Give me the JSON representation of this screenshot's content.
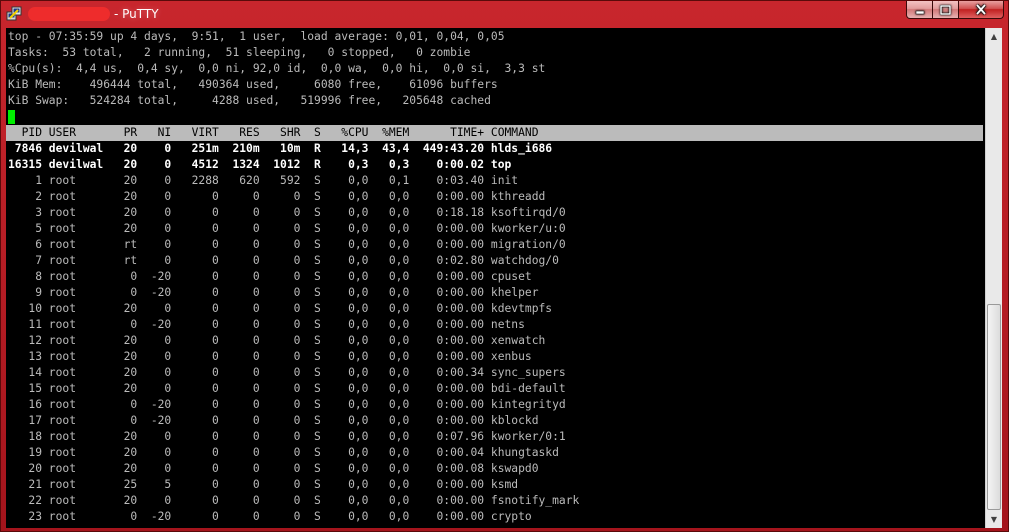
{
  "window": {
    "title": "- PuTTY",
    "colors": {
      "titlebar": "#b81c22",
      "redaction": "#ee2c2c",
      "cursor": "#00ee00",
      "highlight_bar": "#bbbbbb"
    },
    "icons": {
      "app": "putty-icon",
      "minimize": "minimize-icon",
      "maximize": "maximize-icon",
      "close": "close-icon"
    }
  },
  "top": {
    "summary": [
      "top - 07:35:59 up 4 days,  9:51,  1 user,  load average: 0,01, 0,04, 0,05",
      "Tasks:  53 total,   2 running,  51 sleeping,   0 stopped,   0 zombie",
      "%Cpu(s):  4,4 us,  0,4 sy,  0,0 ni, 92,0 id,  0,0 wa,  0,0 hi,  0,0 si,  3,3 st",
      "KiB Mem:    496444 total,   490364 used,     6080 free,    61096 buffers",
      "KiB Swap:   524284 total,     4288 used,   519996 free,   205648 cached"
    ],
    "columns": [
      "PID",
      "USER",
      "PR",
      "NI",
      "VIRT",
      "RES",
      "SHR",
      "S",
      "%CPU",
      "%MEM",
      "TIME+",
      "COMMAND"
    ],
    "processes": [
      {
        "pid": "7846",
        "user": "devilwal",
        "pr": "20",
        "ni": "0",
        "virt": "251m",
        "res": "210m",
        "shr": "10m",
        "s": "R",
        "cpu": "14,3",
        "mem": "43,4",
        "time": "449:43.20",
        "command": "hlds_i686",
        "bold": true
      },
      {
        "pid": "16315",
        "user": "devilwal",
        "pr": "20",
        "ni": "0",
        "virt": "4512",
        "res": "1324",
        "shr": "1012",
        "s": "R",
        "cpu": "0,3",
        "mem": "0,3",
        "time": "0:00.02",
        "command": "top",
        "bold": true
      },
      {
        "pid": "1",
        "user": "root",
        "pr": "20",
        "ni": "0",
        "virt": "2288",
        "res": "620",
        "shr": "592",
        "s": "S",
        "cpu": "0,0",
        "mem": "0,1",
        "time": "0:03.40",
        "command": "init"
      },
      {
        "pid": "2",
        "user": "root",
        "pr": "20",
        "ni": "0",
        "virt": "0",
        "res": "0",
        "shr": "0",
        "s": "S",
        "cpu": "0,0",
        "mem": "0,0",
        "time": "0:00.00",
        "command": "kthreadd"
      },
      {
        "pid": "3",
        "user": "root",
        "pr": "20",
        "ni": "0",
        "virt": "0",
        "res": "0",
        "shr": "0",
        "s": "S",
        "cpu": "0,0",
        "mem": "0,0",
        "time": "0:18.18",
        "command": "ksoftirqd/0"
      },
      {
        "pid": "5",
        "user": "root",
        "pr": "20",
        "ni": "0",
        "virt": "0",
        "res": "0",
        "shr": "0",
        "s": "S",
        "cpu": "0,0",
        "mem": "0,0",
        "time": "0:00.00",
        "command": "kworker/u:0"
      },
      {
        "pid": "6",
        "user": "root",
        "pr": "rt",
        "ni": "0",
        "virt": "0",
        "res": "0",
        "shr": "0",
        "s": "S",
        "cpu": "0,0",
        "mem": "0,0",
        "time": "0:00.00",
        "command": "migration/0"
      },
      {
        "pid": "7",
        "user": "root",
        "pr": "rt",
        "ni": "0",
        "virt": "0",
        "res": "0",
        "shr": "0",
        "s": "S",
        "cpu": "0,0",
        "mem": "0,0",
        "time": "0:02.80",
        "command": "watchdog/0"
      },
      {
        "pid": "8",
        "user": "root",
        "pr": "0",
        "ni": "-20",
        "virt": "0",
        "res": "0",
        "shr": "0",
        "s": "S",
        "cpu": "0,0",
        "mem": "0,0",
        "time": "0:00.00",
        "command": "cpuset"
      },
      {
        "pid": "9",
        "user": "root",
        "pr": "0",
        "ni": "-20",
        "virt": "0",
        "res": "0",
        "shr": "0",
        "s": "S",
        "cpu": "0,0",
        "mem": "0,0",
        "time": "0:00.00",
        "command": "khelper"
      },
      {
        "pid": "10",
        "user": "root",
        "pr": "20",
        "ni": "0",
        "virt": "0",
        "res": "0",
        "shr": "0",
        "s": "S",
        "cpu": "0,0",
        "mem": "0,0",
        "time": "0:00.00",
        "command": "kdevtmpfs"
      },
      {
        "pid": "11",
        "user": "root",
        "pr": "0",
        "ni": "-20",
        "virt": "0",
        "res": "0",
        "shr": "0",
        "s": "S",
        "cpu": "0,0",
        "mem": "0,0",
        "time": "0:00.00",
        "command": "netns"
      },
      {
        "pid": "12",
        "user": "root",
        "pr": "20",
        "ni": "0",
        "virt": "0",
        "res": "0",
        "shr": "0",
        "s": "S",
        "cpu": "0,0",
        "mem": "0,0",
        "time": "0:00.00",
        "command": "xenwatch"
      },
      {
        "pid": "13",
        "user": "root",
        "pr": "20",
        "ni": "0",
        "virt": "0",
        "res": "0",
        "shr": "0",
        "s": "S",
        "cpu": "0,0",
        "mem": "0,0",
        "time": "0:00.00",
        "command": "xenbus"
      },
      {
        "pid": "14",
        "user": "root",
        "pr": "20",
        "ni": "0",
        "virt": "0",
        "res": "0",
        "shr": "0",
        "s": "S",
        "cpu": "0,0",
        "mem": "0,0",
        "time": "0:00.34",
        "command": "sync_supers"
      },
      {
        "pid": "15",
        "user": "root",
        "pr": "20",
        "ni": "0",
        "virt": "0",
        "res": "0",
        "shr": "0",
        "s": "S",
        "cpu": "0,0",
        "mem": "0,0",
        "time": "0:00.00",
        "command": "bdi-default"
      },
      {
        "pid": "16",
        "user": "root",
        "pr": "0",
        "ni": "-20",
        "virt": "0",
        "res": "0",
        "shr": "0",
        "s": "S",
        "cpu": "0,0",
        "mem": "0,0",
        "time": "0:00.00",
        "command": "kintegrityd"
      },
      {
        "pid": "17",
        "user": "root",
        "pr": "0",
        "ni": "-20",
        "virt": "0",
        "res": "0",
        "shr": "0",
        "s": "S",
        "cpu": "0,0",
        "mem": "0,0",
        "time": "0:00.00",
        "command": "kblockd"
      },
      {
        "pid": "18",
        "user": "root",
        "pr": "20",
        "ni": "0",
        "virt": "0",
        "res": "0",
        "shr": "0",
        "s": "S",
        "cpu": "0,0",
        "mem": "0,0",
        "time": "0:07.96",
        "command": "kworker/0:1"
      },
      {
        "pid": "19",
        "user": "root",
        "pr": "20",
        "ni": "0",
        "virt": "0",
        "res": "0",
        "shr": "0",
        "s": "S",
        "cpu": "0,0",
        "mem": "0,0",
        "time": "0:00.04",
        "command": "khungtaskd"
      },
      {
        "pid": "20",
        "user": "root",
        "pr": "20",
        "ni": "0",
        "virt": "0",
        "res": "0",
        "shr": "0",
        "s": "S",
        "cpu": "0,0",
        "mem": "0,0",
        "time": "0:00.08",
        "command": "kswapd0"
      },
      {
        "pid": "21",
        "user": "root",
        "pr": "25",
        "ni": "5",
        "virt": "0",
        "res": "0",
        "shr": "0",
        "s": "S",
        "cpu": "0,0",
        "mem": "0,0",
        "time": "0:00.00",
        "command": "ksmd"
      },
      {
        "pid": "22",
        "user": "root",
        "pr": "20",
        "ni": "0",
        "virt": "0",
        "res": "0",
        "shr": "0",
        "s": "S",
        "cpu": "0,0",
        "mem": "0,0",
        "time": "0:00.00",
        "command": "fsnotify_mark"
      },
      {
        "pid": "23",
        "user": "root",
        "pr": "0",
        "ni": "-20",
        "virt": "0",
        "res": "0",
        "shr": "0",
        "s": "S",
        "cpu": "0,0",
        "mem": "0,0",
        "time": "0:00.00",
        "command": "crypto"
      }
    ]
  }
}
